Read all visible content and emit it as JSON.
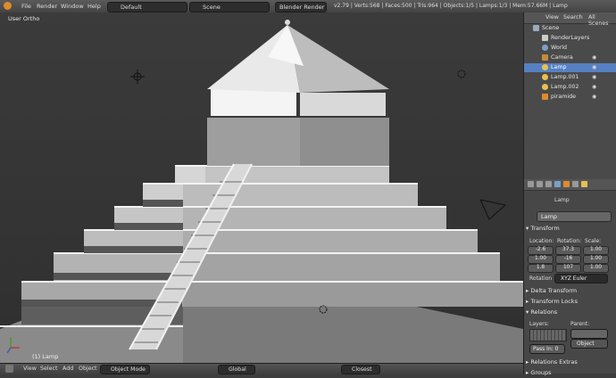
{
  "menu": {
    "file": "File",
    "render": "Render",
    "window": "Window",
    "help": "Help",
    "screen_layout": "Default",
    "scene": "Scene",
    "render_engine": "Blender Render",
    "stats": "v2.79 | Verts:568 | Faces:500 | Tris:964 | Objects:1/5 | Lamps:1/3 | Mem:57.66M | Lamp"
  },
  "viewport": {
    "view_label": "User Ortho",
    "active_object_label": "(1) Lamp"
  },
  "footer": {
    "view": "View",
    "select": "Select",
    "add": "Add",
    "object": "Object",
    "mode": "Object Mode",
    "orientation": "Global",
    "snap": "Closest"
  },
  "outliner": {
    "tabs": [
      "View",
      "Search",
      "All Scenes"
    ],
    "items": [
      "Scene",
      "RenderLayers",
      "World",
      "Camera",
      "Lamp",
      "Lamp.001",
      "Lamp.002",
      "piramide"
    ]
  },
  "properties": {
    "breadcrumb": "Lamp",
    "object_name": "Lamp",
    "transform_header": "Transform",
    "location_label": "Location:",
    "rotation_label": "Rotation:",
    "scale_label": "Scale:",
    "location": [
      "-2.6",
      "1.00",
      "1.8"
    ],
    "rotation": [
      "37.3",
      "-16",
      "107"
    ],
    "scale": [
      "1.00",
      "1.00",
      "1.00"
    ],
    "rotation_mode_label": "Rotation",
    "rotation_mode": "XYZ Euler",
    "delta_header": "Delta Transform",
    "locks_header": "Transform Locks",
    "relations_header": "Relations",
    "layers_label": "Layers:",
    "parent_label": "Parent:",
    "parent_type": "Object",
    "pass_index": "Pass In: 0",
    "relations_extras_header": "Relations Extras",
    "groups_header": "Groups"
  },
  "colors": {
    "accent_orange": "#e08a2c",
    "selection_blue": "#5680c2",
    "header_gray": "#555555"
  }
}
